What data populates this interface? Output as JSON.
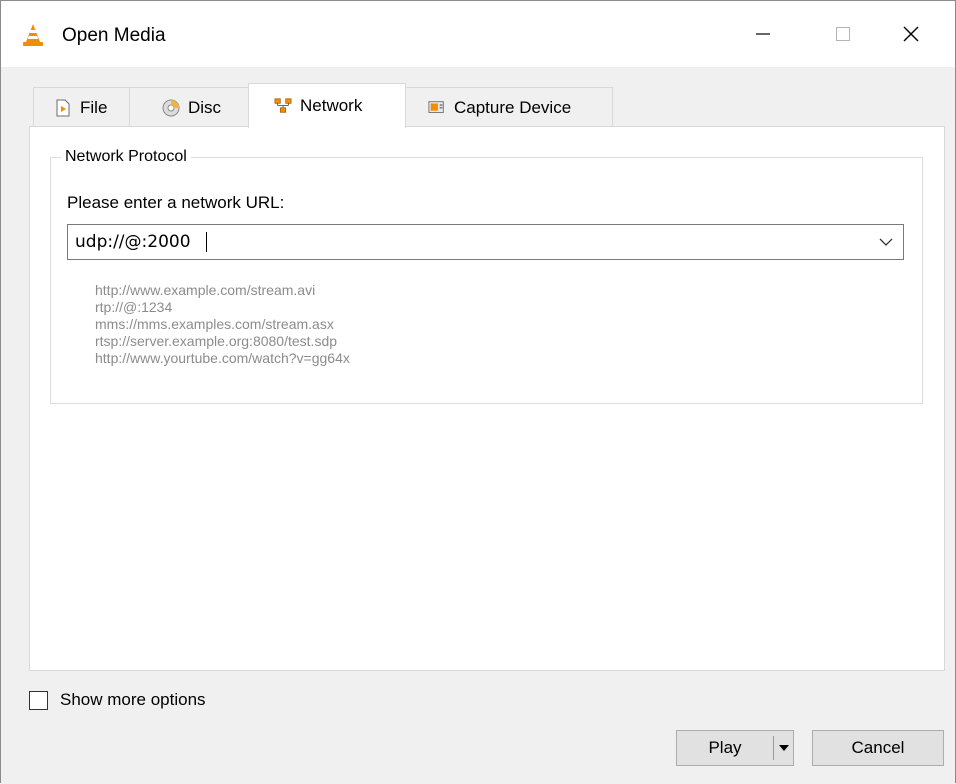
{
  "window": {
    "title": "Open Media"
  },
  "tabs": [
    {
      "label": "File",
      "icon": "file-play-icon",
      "active": false
    },
    {
      "label": "Disc",
      "icon": "disc-icon",
      "active": false
    },
    {
      "label": "Network",
      "icon": "network-icon",
      "active": true
    },
    {
      "label": "Capture Device",
      "icon": "capture-device-icon",
      "active": false
    }
  ],
  "network": {
    "group_title": "Network Protocol",
    "url_label": "Please enter a network URL:",
    "url_value": "udp://@:2000",
    "examples": [
      "http://www.example.com/stream.avi",
      "rtp://@:1234",
      "mms://mms.examples.com/stream.asx",
      "rtsp://server.example.org:8080/test.sdp",
      "http://www.yourtube.com/watch?v=gg64x"
    ]
  },
  "options": {
    "show_more_label": "Show more options",
    "show_more_checked": false
  },
  "buttons": {
    "play_label": "Play",
    "cancel_label": "Cancel"
  },
  "colors": {
    "vlc_orange": "#f28c00",
    "hint_text": "#8c8c8c",
    "button_face": "#e1e1e1"
  }
}
